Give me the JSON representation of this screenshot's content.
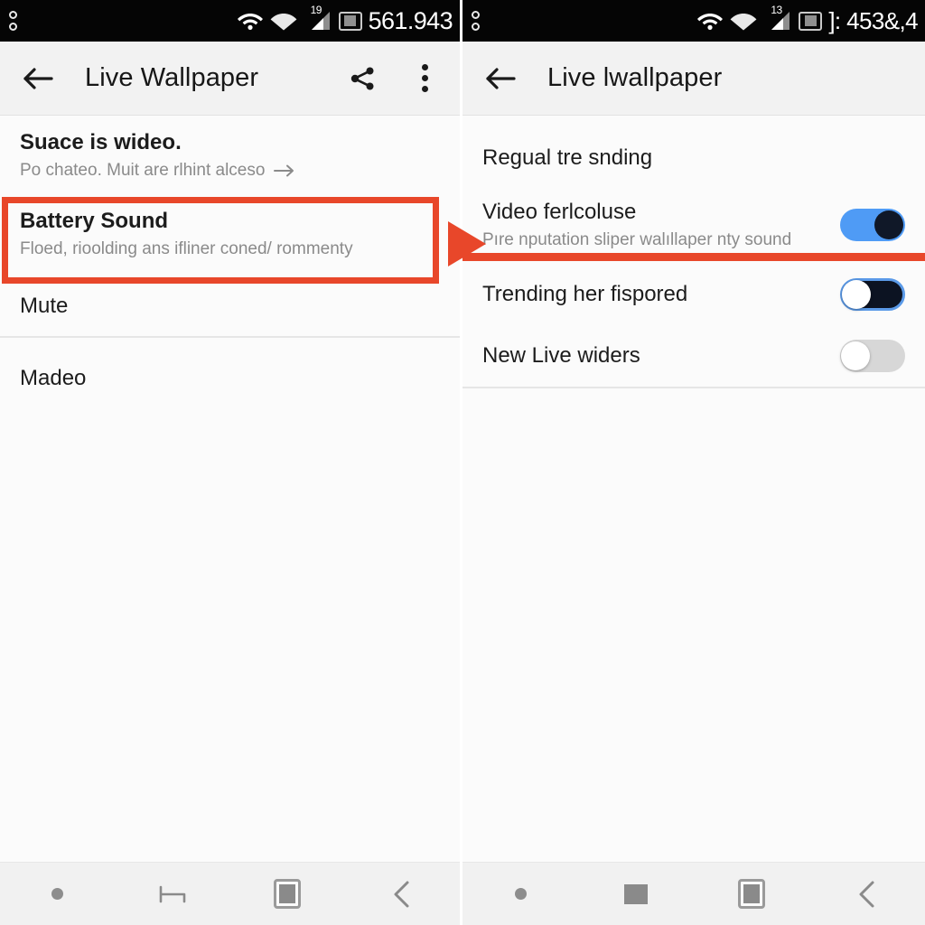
{
  "left_screen": {
    "status_bar": {
      "left_icon": "two-rings-icon",
      "wifi_icon": "wifi-icon",
      "wifi_icon_2": "wifi-filled-icon",
      "signal_temp": "19",
      "battery_icon": "battery-icon",
      "status_text": "561.943"
    },
    "app_bar": {
      "back_icon": "back-arrow-icon",
      "title": "Live Wallpaper",
      "share_icon": "share-icon",
      "overflow_icon": "more-vertical-icon"
    },
    "rows": [
      {
        "title": "Suace is wideo.",
        "subtitle": "Po chateo. Muit are rlhint alceso",
        "trailing_icon": "arrow-right-icon"
      },
      {
        "title": "Battery Sound",
        "subtitle": "Floed, rioolding ans ifliner coned/ rommenty",
        "highlighted": true
      },
      {
        "title": "Mute",
        "subtitle": ""
      },
      {
        "title": "Madeo",
        "subtitle": ""
      }
    ],
    "nav_bar": {
      "dot_icon": "circle-icon",
      "home_icon": "bracket-icon",
      "recents_icon": "recents-icon",
      "back_icon": "chevron-left-icon"
    }
  },
  "right_screen": {
    "status_bar": {
      "left_icon": "two-rings-icon",
      "wifi_icon": "wifi-icon",
      "wifi_icon_2": "wifi-filled-icon",
      "signal_temp": "13",
      "battery_icon": "battery-icon",
      "status_text": "]: 453&,4"
    },
    "app_bar": {
      "back_icon": "back-arrow-icon",
      "title": "Live lwallpaper"
    },
    "section_header": "Regual tre snding",
    "rows": [
      {
        "title": "Video ferlcoluse",
        "subtitle": "Pıre nputation sliper walıllaper nty sound",
        "toggle": "on-blue"
      },
      {
        "title": "Trending her fispored",
        "subtitle": "",
        "toggle": "on-dark"
      },
      {
        "title": "New Live widers",
        "subtitle": "",
        "toggle": "off-gray"
      }
    ],
    "nav_bar": {
      "dot_icon": "circle-icon",
      "home_icon": "square-icon",
      "recents_icon": "recents-icon",
      "back_icon": "chevron-left-icon"
    }
  },
  "annotations": {
    "highlight_color": "#e8472a",
    "pointer_icon": "right-triangle-pointer-icon",
    "underline_color": "#e8472a"
  }
}
